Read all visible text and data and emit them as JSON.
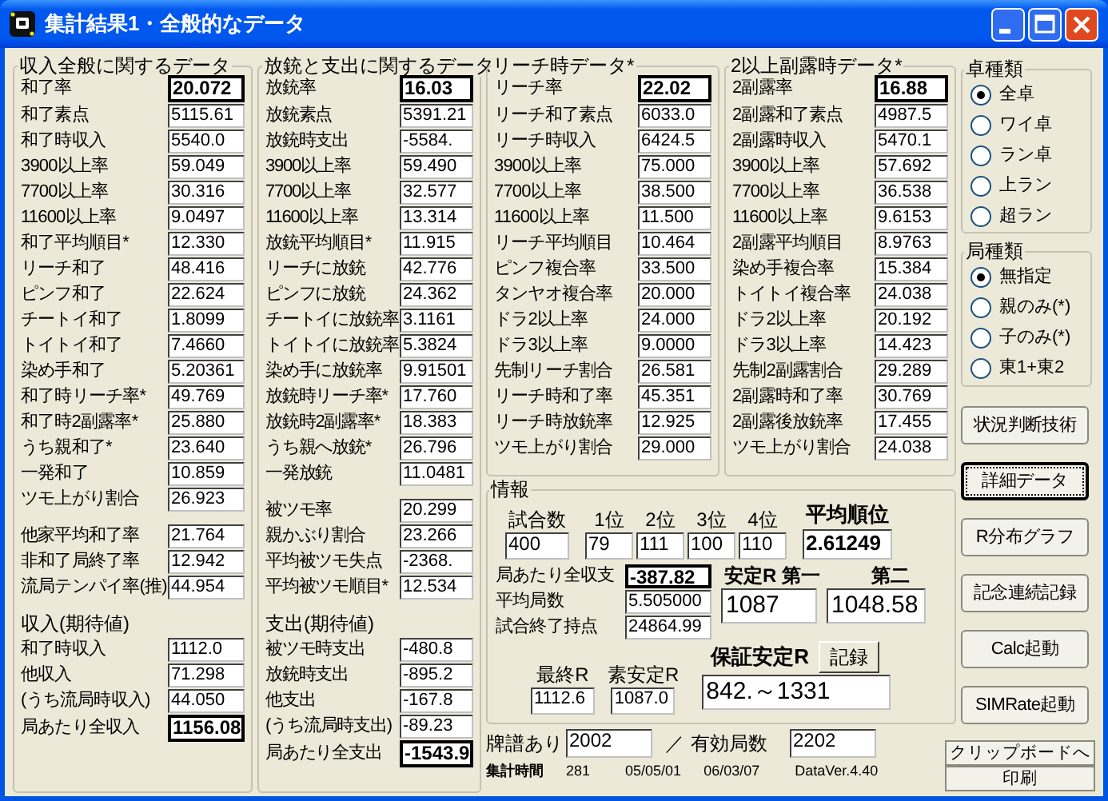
{
  "window": {
    "title": "集計結果1・全般的なデータ"
  },
  "income": {
    "title": "収入全般に関するデータ",
    "sections": [
      {
        "rows": [
          {
            "label": "和了率",
            "value": "20.072",
            "bold": true
          },
          {
            "label": "和了素点",
            "value": "5115.61",
            "bold": false
          },
          {
            "label": "和了時収入",
            "value": "5540.0",
            "bold": false
          },
          {
            "label": "3900以上率",
            "value": "59.049",
            "bold": false
          },
          {
            "label": "7700以上率",
            "value": "30.316",
            "bold": false
          },
          {
            "label": "11600以上率",
            "value": "9.0497",
            "bold": false
          },
          {
            "label": "和了平均順目*",
            "value": "12.330",
            "bold": false
          },
          {
            "label": "リーチ和了",
            "value": "48.416",
            "bold": false
          },
          {
            "label": "ピンフ和了",
            "value": "22.624",
            "bold": false
          },
          {
            "label": "チートイ和了",
            "value": "1.8099",
            "bold": false
          },
          {
            "label": "トイトイ和了",
            "value": "7.4660",
            "bold": false
          },
          {
            "label": "染め手和了",
            "value": "5.20361",
            "bold": false
          },
          {
            "label": "和了時リーチ率*",
            "value": "49.769",
            "bold": false
          },
          {
            "label": "和了時2副露率*",
            "value": "25.880",
            "bold": false
          },
          {
            "label": "うち親和了*",
            "value": "23.640",
            "bold": false
          },
          {
            "label": "一発和了",
            "value": "10.859",
            "bold": false
          },
          {
            "label": "ツモ上がり割合",
            "value": "26.923",
            "bold": false
          }
        ]
      },
      {
        "rows": [
          {
            "label": "他家平均和了率",
            "value": "21.764",
            "bold": false
          },
          {
            "label": "非和了局終了率",
            "value": "12.942",
            "bold": false
          },
          {
            "label": "流局テンパイ率(推)",
            "value": "44.954",
            "bold": false
          }
        ]
      },
      {
        "heading": "収入(期待値)",
        "rows": [
          {
            "label": "和了時収入",
            "value": "1112.0",
            "bold": false
          },
          {
            "label": "他収入",
            "value": "71.298",
            "bold": false
          },
          {
            "label": "(うち流局時収入)",
            "value": "44.050",
            "bold": false
          },
          {
            "label": "局あたり全収入",
            "value": "1156.08",
            "bold": true
          }
        ]
      }
    ]
  },
  "payout": {
    "title": "放銃と支出に関するデータ",
    "sections": [
      {
        "rows": [
          {
            "label": "放銃率",
            "value": "16.03",
            "bold": true
          },
          {
            "label": "放銃素点",
            "value": "5391.21",
            "bold": false
          },
          {
            "label": "放銃時支出",
            "value": "-5584.",
            "bold": false
          },
          {
            "label": "3900以上率",
            "value": "59.490",
            "bold": false
          },
          {
            "label": "7700以上率",
            "value": "32.577",
            "bold": false
          },
          {
            "label": "11600以上率",
            "value": "13.314",
            "bold": false
          },
          {
            "label": "放銃平均順目*",
            "value": "11.915",
            "bold": false
          },
          {
            "label": "リーチに放銃",
            "value": "42.776",
            "bold": false
          },
          {
            "label": "ピンフに放銃",
            "value": "24.362",
            "bold": false
          },
          {
            "label": "チートイに放銃率",
            "value": "3.1161",
            "bold": false
          },
          {
            "label": "トイトイに放銃率",
            "value": "5.3824",
            "bold": false
          },
          {
            "label": "染め手に放銃率",
            "value": "9.91501",
            "bold": false
          },
          {
            "label": "放銃時リーチ率*",
            "value": "17.760",
            "bold": false
          },
          {
            "label": "放銃時2副露率*",
            "value": "18.383",
            "bold": false
          },
          {
            "label": "うち親へ放銃*",
            "value": "26.796",
            "bold": false
          },
          {
            "label": "一発放銃",
            "value": "11.0481",
            "bold": false
          }
        ]
      },
      {
        "rows": [
          {
            "label": "被ツモ率",
            "value": "20.299",
            "bold": false
          },
          {
            "label": "親かぶり割合",
            "value": "23.266",
            "bold": false
          },
          {
            "label": "平均被ツモ失点",
            "value": "-2368.",
            "bold": false
          },
          {
            "label": "平均被ツモ順目*",
            "value": "12.534",
            "bold": false
          }
        ]
      },
      {
        "heading": "支出(期待値)",
        "rows": [
          {
            "label": "被ツモ時支出",
            "value": "-480.8",
            "bold": false
          },
          {
            "label": "放銃時支出",
            "value": "-895.2",
            "bold": false
          },
          {
            "label": "他支出",
            "value": "-167.8",
            "bold": false
          },
          {
            "label": "(うち流局時支出)",
            "value": "-89.23",
            "bold": false
          },
          {
            "label": "局あたり全支出",
            "value": "-1543.9",
            "bold": true
          }
        ]
      }
    ]
  },
  "riichi": {
    "title": "リーチ時データ*",
    "sections": [
      {
        "rows": [
          {
            "label": "リーチ率",
            "value": "22.02",
            "bold": true
          },
          {
            "label": "リーチ和了素点",
            "value": "6033.0",
            "bold": false
          },
          {
            "label": "リーチ時収入",
            "value": "6424.5",
            "bold": false
          },
          {
            "label": "3900以上率",
            "value": "75.000",
            "bold": false
          },
          {
            "label": "7700以上率",
            "value": "38.500",
            "bold": false
          },
          {
            "label": "11600以上率",
            "value": "11.500",
            "bold": false
          },
          {
            "label": "リーチ平均順目",
            "value": "10.464",
            "bold": false
          },
          {
            "label": "ピンフ複合率",
            "value": "33.500",
            "bold": false
          },
          {
            "label": "タンヤオ複合率",
            "value": "20.000",
            "bold": false
          },
          {
            "label": "ドラ2以上率",
            "value": "24.000",
            "bold": false
          },
          {
            "label": "ドラ3以上率",
            "value": "9.0000",
            "bold": false
          },
          {
            "label": "先制リーチ割合",
            "value": "26.581",
            "bold": false
          },
          {
            "label": "リーチ時和了率",
            "value": "45.351",
            "bold": false
          },
          {
            "label": "リーチ時放銃率",
            "value": "12.925",
            "bold": false
          },
          {
            "label": "ツモ上がり割合",
            "value": "29.000",
            "bold": false
          }
        ]
      }
    ]
  },
  "furo": {
    "title": "2以上副露時データ*",
    "sections": [
      {
        "rows": [
          {
            "label": "2副露率",
            "value": "16.88",
            "bold": true
          },
          {
            "label": "2副露和了素点",
            "value": "4987.5",
            "bold": false
          },
          {
            "label": "2副露時収入",
            "value": "5470.1",
            "bold": false
          },
          {
            "label": "3900以上率",
            "value": "57.692",
            "bold": false
          },
          {
            "label": "7700以上率",
            "value": "36.538",
            "bold": false
          },
          {
            "label": "11600以上率",
            "value": "9.6153",
            "bold": false
          },
          {
            "label": "2副露平均順目",
            "value": "8.9763",
            "bold": false
          },
          {
            "label": "染め手複合率",
            "value": "15.384",
            "bold": false
          },
          {
            "label": "トイトイ複合率",
            "value": "24.038",
            "bold": false
          },
          {
            "label": "ドラ2以上率",
            "value": "20.192",
            "bold": false
          },
          {
            "label": "ドラ3以上率",
            "value": "14.423",
            "bold": false
          },
          {
            "label": "先制2副露割合",
            "value": "29.289",
            "bold": false
          },
          {
            "label": "2副露時和了率",
            "value": "30.769",
            "bold": false
          },
          {
            "label": "2副露後放銃率",
            "value": "17.455",
            "bold": false
          },
          {
            "label": "ツモ上がり割合",
            "value": "24.038",
            "bold": false
          }
        ]
      }
    ]
  },
  "info": {
    "title": "情報",
    "games_label": "試合数",
    "games": "400",
    "places": [
      {
        "label": "1位",
        "value": "79"
      },
      {
        "label": "2位",
        "value": "111"
      },
      {
        "label": "3位",
        "value": "100"
      },
      {
        "label": "4位",
        "value": "110"
      }
    ],
    "avg_rank_label": "平均順位",
    "avg_rank": "2.61249",
    "stats": [
      {
        "label": "局あたり全収支",
        "value": "-387.82",
        "bold": true
      },
      {
        "label": "平均局数",
        "value": "5.505000",
        "bold": false
      },
      {
        "label": "試合終了持点",
        "value": "24864.99",
        "bold": false
      }
    ],
    "stable_first_label": "安定R 第一",
    "stable_second_label": "第二",
    "stable_first": "1087",
    "stable_second": "1048.58",
    "final_r_label": "最終R",
    "final_r": "1112.6",
    "raw_r_label": "素安定R",
    "raw_r": "1087.0",
    "guaranteed_label": "保証安定R",
    "record_button": "記録",
    "guaranteed_range": "842.～1331"
  },
  "footer": {
    "paifu_label": "牌譜あり",
    "paifu": "2002",
    "separator": "／",
    "valid_label": "有効局数",
    "valid": "2202",
    "time_label": "集計時間",
    "time": "281",
    "date_from": "05/05/01",
    "date_to": "06/03/07",
    "version": "DataVer.4.40"
  },
  "table_type": {
    "title": "卓種類",
    "options": [
      {
        "label": "全卓",
        "selected": true
      },
      {
        "label": "ワイ卓",
        "selected": false
      },
      {
        "label": "ラン卓",
        "selected": false
      },
      {
        "label": "上ラン",
        "selected": false
      },
      {
        "label": "超ラン",
        "selected": false
      }
    ]
  },
  "round_type": {
    "title": "局種類",
    "options": [
      {
        "label": "無指定",
        "selected": true
      },
      {
        "label": "親のみ(*)",
        "selected": false
      },
      {
        "label": "子のみ(*)",
        "selected": false
      },
      {
        "label": "東1+東2",
        "selected": false
      }
    ]
  },
  "buttons": [
    {
      "label": "状況判断技術",
      "default": false
    },
    {
      "label": "詳細データ",
      "default": true
    },
    {
      "label": "R分布グラフ",
      "default": false
    },
    {
      "label": "記念連続記録",
      "default": false
    },
    {
      "label": "Calc起動",
      "default": false
    },
    {
      "label": "SIMRate起動",
      "default": false
    }
  ],
  "clipboard_button": "クリップボードへ",
  "print_button": "印刷"
}
